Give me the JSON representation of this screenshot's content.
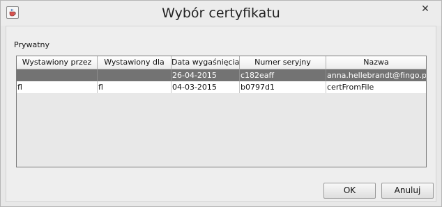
{
  "window": {
    "title": "Wybór certyfikatu",
    "close_glyph": "✕"
  },
  "section": {
    "label": "Prywatny"
  },
  "table": {
    "columns": [
      "Wystawiony przez",
      "Wystawiony dla",
      "Data wygaśnięcia",
      "Numer seryjny",
      "Nazwa"
    ],
    "rows": [
      {
        "issued_by": "",
        "issued_to": "",
        "expiry": "26-04-2015",
        "serial": "c182eaff",
        "name": "anna.hellebrandt@fingo.pl",
        "selected": true
      },
      {
        "issued_by": "fl",
        "issued_to": "fl",
        "expiry": "04-03-2015",
        "serial": "b0797d1",
        "name": "certFromFile",
        "selected": false
      }
    ]
  },
  "buttons": {
    "ok": "OK",
    "cancel": "Anuluj"
  },
  "colors": {
    "selection": "#737373",
    "background": "#e8e8e8"
  },
  "icons": {
    "app": "java-cup-icon",
    "close": "close-icon"
  }
}
